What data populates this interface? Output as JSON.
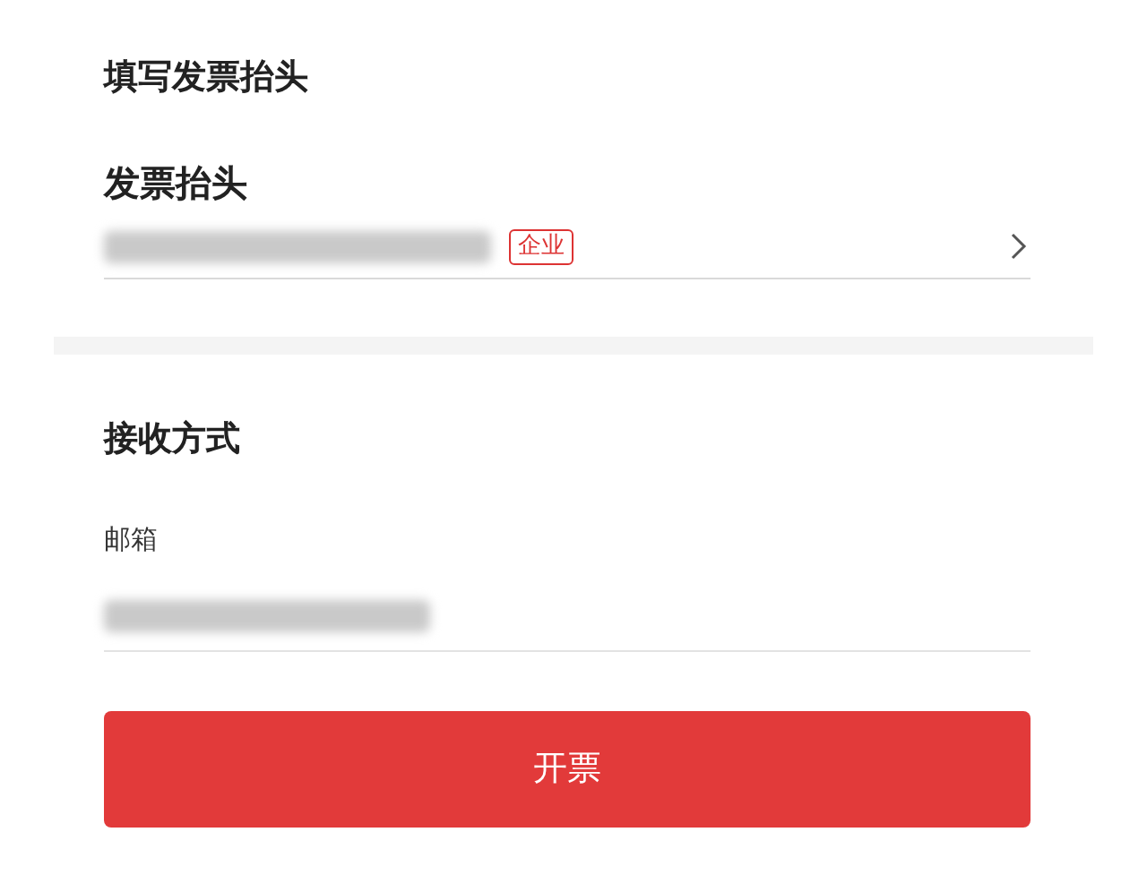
{
  "page_title": "填写发票抬头",
  "invoice_header": {
    "label": "发票抬头",
    "value_redacted": true,
    "badge": "企业"
  },
  "delivery": {
    "title": "接收方式",
    "email_label": "邮箱",
    "email_redacted": true
  },
  "submit_button": "开票"
}
